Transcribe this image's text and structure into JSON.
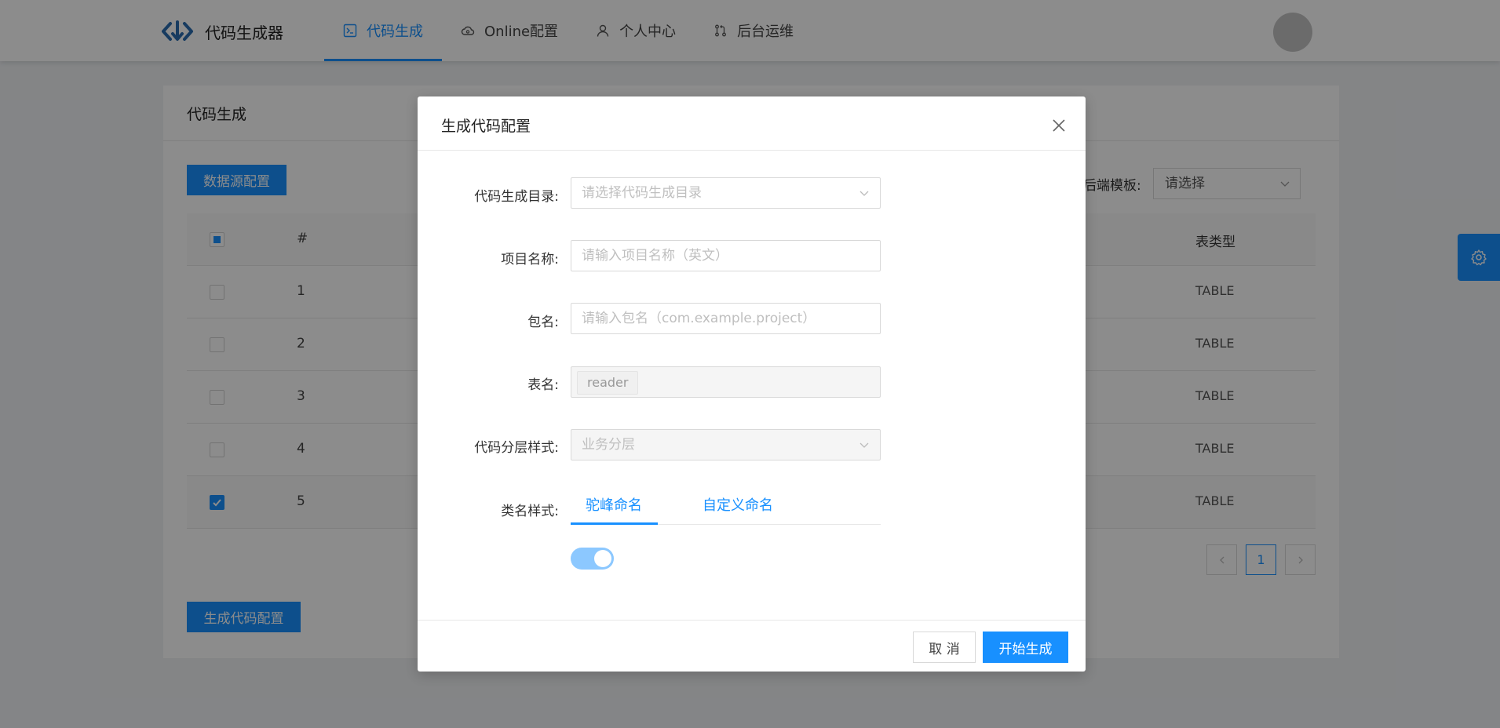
{
  "app": {
    "title": "代码生成器",
    "nav": [
      {
        "label": "代码生成",
        "icon": "terminal-icon"
      },
      {
        "label": "Online配置",
        "icon": "cloud-icon"
      },
      {
        "label": "个人中心",
        "icon": "user-icon"
      },
      {
        "label": "后台运维",
        "icon": "pull-request-icon"
      }
    ]
  },
  "page": {
    "title": "代码生成",
    "datasource_button": "数据源配置",
    "generate_button": "生成代码配置",
    "backend_template_label": "后端模板:",
    "backend_template_value": "请选择",
    "table": {
      "headers": {
        "num": "#",
        "type": "表类型"
      },
      "rows": [
        {
          "num": "1",
          "type": "TABLE",
          "checked": false
        },
        {
          "num": "2",
          "type": "TABLE",
          "checked": false
        },
        {
          "num": "3",
          "type": "TABLE",
          "checked": false
        },
        {
          "num": "4",
          "type": "TABLE",
          "checked": false
        },
        {
          "num": "5",
          "type": "TABLE",
          "checked": true
        }
      ]
    },
    "pagination": {
      "current": "1"
    }
  },
  "modal": {
    "title": "生成代码配置",
    "fields": {
      "dir_label": "代码生成目录:",
      "dir_placeholder": "请选择代码生成目录",
      "project_label": "项目名称:",
      "project_placeholder": "请输入项目名称（英文）",
      "package_label": "包名:",
      "package_placeholder": "请输入包名（com.example.project）",
      "table_label": "表名:",
      "table_tag": "reader",
      "layer_label": "代码分层样式:",
      "layer_value": "业务分层",
      "class_label": "类名样式:"
    },
    "tabs": [
      "驼峰命名",
      "自定义命名"
    ],
    "cancel": "取 消",
    "start": "开始生成"
  },
  "colors": {
    "primary": "#1890ff"
  }
}
